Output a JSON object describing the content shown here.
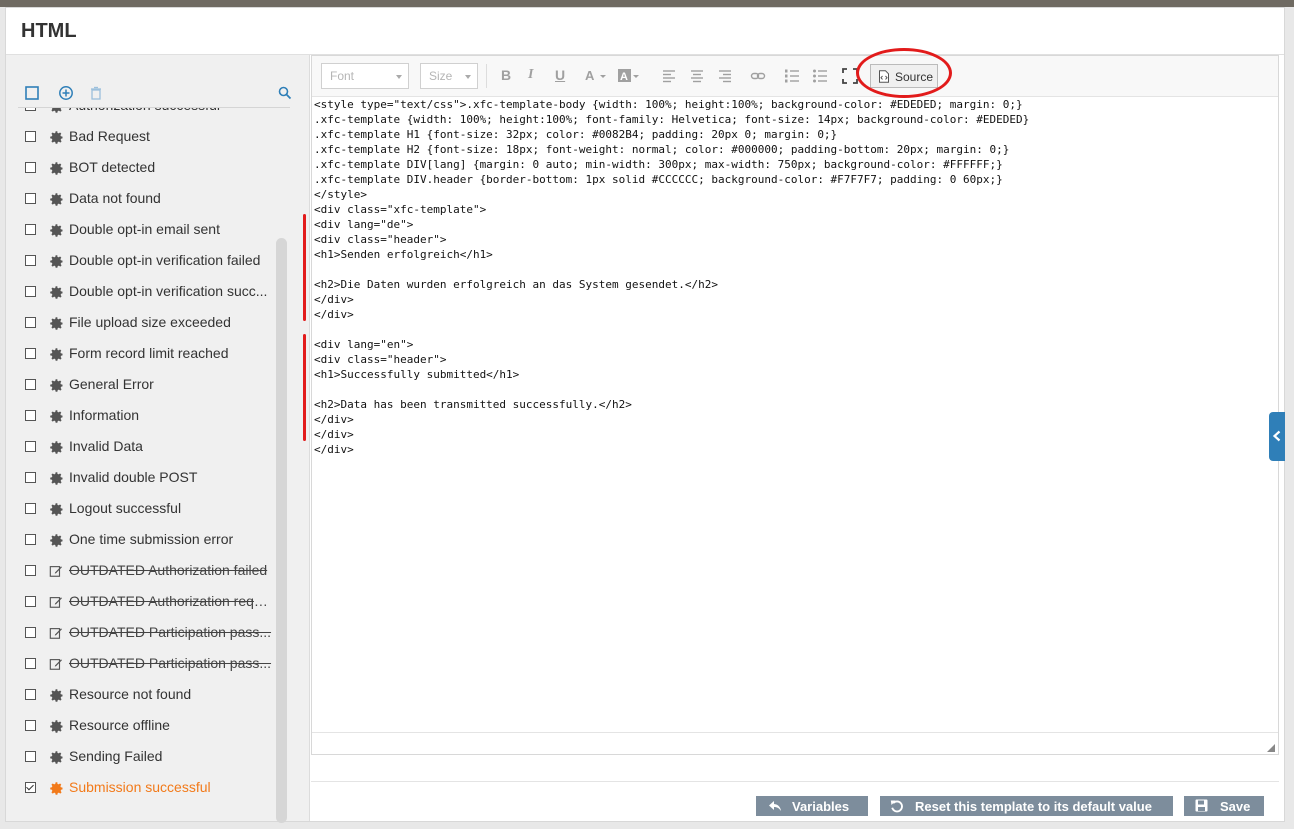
{
  "panel": {
    "title": "HTML"
  },
  "sidebar": {
    "items": [
      {
        "label": "Authorization successful",
        "icon": "gear-icon",
        "checked": false,
        "struck": false,
        "active": false
      },
      {
        "label": "Bad Request",
        "icon": "gear-icon",
        "checked": false,
        "struck": false,
        "active": false
      },
      {
        "label": "BOT detected",
        "icon": "gear-icon",
        "checked": false,
        "struck": false,
        "active": false
      },
      {
        "label": "Data not found",
        "icon": "gear-icon",
        "checked": false,
        "struck": false,
        "active": false
      },
      {
        "label": "Double opt-in email sent",
        "icon": "gear-icon",
        "checked": false,
        "struck": false,
        "active": false
      },
      {
        "label": "Double opt-in verification failed",
        "icon": "gear-icon",
        "checked": false,
        "struck": false,
        "active": false
      },
      {
        "label": "Double opt-in verification succ...",
        "icon": "gear-icon",
        "checked": false,
        "struck": false,
        "active": false
      },
      {
        "label": "File upload size exceeded",
        "icon": "gear-icon",
        "checked": false,
        "struck": false,
        "active": false
      },
      {
        "label": "Form record limit reached",
        "icon": "gear-icon",
        "checked": false,
        "struck": false,
        "active": false
      },
      {
        "label": "General Error",
        "icon": "gear-icon",
        "checked": false,
        "struck": false,
        "active": false
      },
      {
        "label": "Information",
        "icon": "gear-icon",
        "checked": false,
        "struck": false,
        "active": false
      },
      {
        "label": "Invalid Data",
        "icon": "gear-icon",
        "checked": false,
        "struck": false,
        "active": false
      },
      {
        "label": "Invalid double POST",
        "icon": "gear-icon",
        "checked": false,
        "struck": false,
        "active": false
      },
      {
        "label": "Logout successful",
        "icon": "gear-icon",
        "checked": false,
        "struck": false,
        "active": false
      },
      {
        "label": "One time submission error",
        "icon": "gear-icon",
        "checked": false,
        "struck": false,
        "active": false
      },
      {
        "label": "OUTDATED Authorization failed",
        "icon": "edit-icon",
        "checked": false,
        "struck": true,
        "active": false
      },
      {
        "label": "OUTDATED Authorization requi...",
        "icon": "edit-icon",
        "checked": false,
        "struck": true,
        "active": false
      },
      {
        "label": "OUTDATED Participation pass...",
        "icon": "edit-icon",
        "checked": false,
        "struck": true,
        "active": false
      },
      {
        "label": "OUTDATED Participation pass...",
        "icon": "edit-icon",
        "checked": false,
        "struck": true,
        "active": false
      },
      {
        "label": "Resource not found",
        "icon": "gear-icon",
        "checked": false,
        "struck": false,
        "active": false
      },
      {
        "label": "Resource offline",
        "icon": "gear-icon",
        "checked": false,
        "struck": false,
        "active": false
      },
      {
        "label": "Sending Failed",
        "icon": "gear-icon",
        "checked": false,
        "struck": false,
        "active": false
      },
      {
        "label": "Submission successful",
        "icon": "gear-icon",
        "checked": true,
        "struck": false,
        "active": true
      }
    ]
  },
  "toolbar": {
    "font_placeholder": "Font",
    "size_placeholder": "Size",
    "source_label": "Source"
  },
  "code_lines": [
    "<style type=\"text/css\">.xfc-template-body {width: 100%; height:100%; background-color: #EDEDED; margin: 0;}",
    ".xfc-template {width: 100%; height:100%; font-family: Helvetica; font-size: 14px; background-color: #EDEDED}",
    ".xfc-template H1 {font-size: 32px; color: #0082B4; padding: 20px 0; margin: 0;}",
    ".xfc-template H2 {font-size: 18px; font-weight: normal; color: #000000; padding-bottom: 20px; margin: 0;}",
    ".xfc-template DIV[lang] {margin: 0 auto; min-width: 300px; max-width: 750px; background-color: #FFFFFF;}",
    ".xfc-template DIV.header {border-bottom: 1px solid #CCCCCC; background-color: #F7F7F7; padding: 0 60px;}",
    "</style>",
    "<div class=\"xfc-template\">",
    "<div lang=\"de\">",
    "<div class=\"header\">",
    "<h1>Senden erfolgreich</h1>",
    "",
    "<h2>Die Daten wurden erfolgreich an das System gesendet.</h2>",
    "</div>",
    "</div>",
    "",
    "<div lang=\"en\">",
    "<div class=\"header\">",
    "<h1>Successfully submitted</h1>",
    "",
    "<h2>Data has been transmitted successfully.</h2>",
    "</div>",
    "</div>",
    "</div>"
  ],
  "footer": {
    "variables_label": "Variables",
    "reset_label": "Reset this template to its default value",
    "save_label": "Save"
  },
  "colors": {
    "active_item": "#f27a1a",
    "footer_button": "#7d8d9c",
    "annotation_red": "#e21b1b",
    "side_tab": "#2f7fb8"
  }
}
